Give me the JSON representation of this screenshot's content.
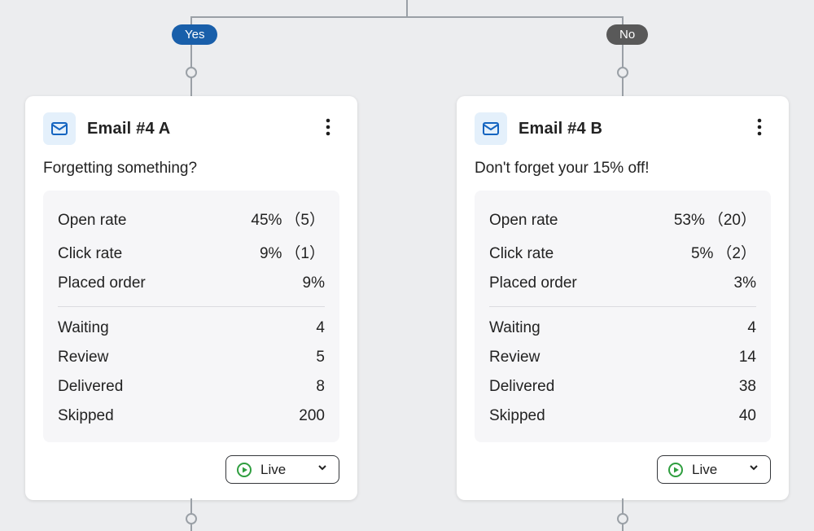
{
  "branch": {
    "yes_label": "Yes",
    "no_label": "No"
  },
  "cards": {
    "a": {
      "title": "Email #4 A",
      "subject": "Forgetting something?",
      "labels": {
        "open_rate": "Open rate",
        "click_rate": "Click rate",
        "placed_order": "Placed order",
        "waiting": "Waiting",
        "review": "Review",
        "delivered": "Delivered",
        "skipped": "Skipped"
      },
      "metrics": {
        "open_rate_pct": "45%",
        "open_rate_count": "（5）",
        "click_rate_pct": "9%",
        "click_rate_count": "（1）",
        "placed_order_pct": "9%",
        "waiting": "4",
        "review": "5",
        "delivered": "8",
        "skipped": "200"
      },
      "status": "Live"
    },
    "b": {
      "title": "Email #4 B",
      "subject": "Don't forget your 15% off!",
      "labels": {
        "open_rate": "Open rate",
        "click_rate": "Click rate",
        "placed_order": "Placed order",
        "waiting": "Waiting",
        "review": "Review",
        "delivered": "Delivered",
        "skipped": "Skipped"
      },
      "metrics": {
        "open_rate_pct": "53%",
        "open_rate_count": "（20）",
        "click_rate_pct": "5%",
        "click_rate_count": "（2）",
        "placed_order_pct": "3%",
        "waiting": "4",
        "review": "14",
        "delivered": "38",
        "skipped": "40"
      },
      "status": "Live"
    }
  }
}
